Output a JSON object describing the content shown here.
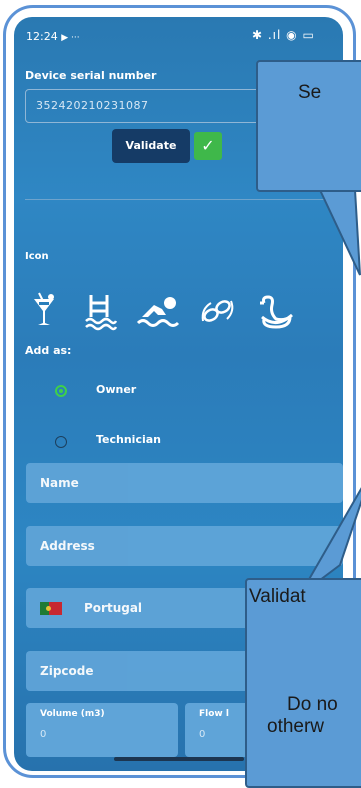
{
  "status_bar": {
    "time": "12:24",
    "extra": "▶ ···",
    "icons": "✱ .ıl ◉ ▭"
  },
  "form": {
    "serial_label": "Device serial number",
    "serial_value": "352420210231087",
    "validate_label": "Validate",
    "check_glyph": "✓",
    "icon_label": "Icon",
    "icons": [
      "cocktail-icon",
      "pool-ladder-icon",
      "swimmer-icon",
      "goggles-icon",
      "swan-float-icon"
    ],
    "add_as_label": "Add as:",
    "options": [
      {
        "label": "Owner",
        "selected": true
      },
      {
        "label": "Technician",
        "selected": false
      }
    ],
    "name_placeholder": "Name",
    "address_placeholder": "Address",
    "country_value": "Portugal",
    "zipcode_placeholder": "Zipcode",
    "volume_label": "Volume (m3)",
    "volume_value": "0",
    "flow_label": "Flow l",
    "flow_value": "0"
  },
  "callouts": {
    "top": "Se",
    "bottom_line1": "Validat",
    "bottom_line2": "Do no",
    "bottom_line3": "otherw"
  },
  "colors": {
    "frame": "#5b92d6",
    "check_green": "#3fb84a",
    "validate_bg": "#153b66",
    "callout": "#5b9bd5"
  }
}
